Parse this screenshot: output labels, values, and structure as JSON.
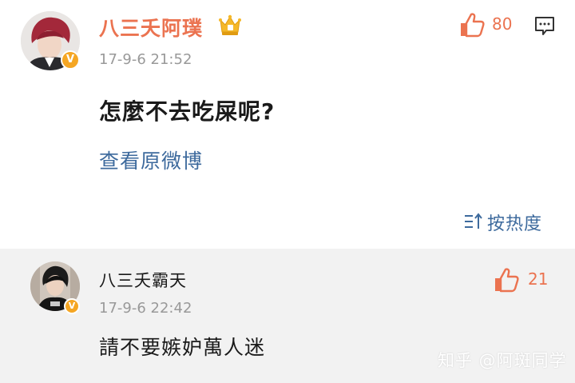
{
  "post": {
    "author": {
      "name": "八三夭阿璞",
      "verified_mark": "V",
      "badge_icon": "crown-icon",
      "name_color": "#eb7350"
    },
    "timestamp": "17-9-6 21:52",
    "likes": "80",
    "content": "怎麼不去吃屎呢?",
    "view_original_label": "查看原微博",
    "sort_label": "按热度",
    "accent_color": "#eb7350",
    "link_color": "#3d6a9d"
  },
  "reply": {
    "author": {
      "name": "八三夭霸天",
      "verified_mark": "V"
    },
    "timestamp": "17-9-6 22:42",
    "likes": "21",
    "content": "請不要嫉妒萬人迷"
  },
  "watermark": "知乎 @阿斑同学"
}
